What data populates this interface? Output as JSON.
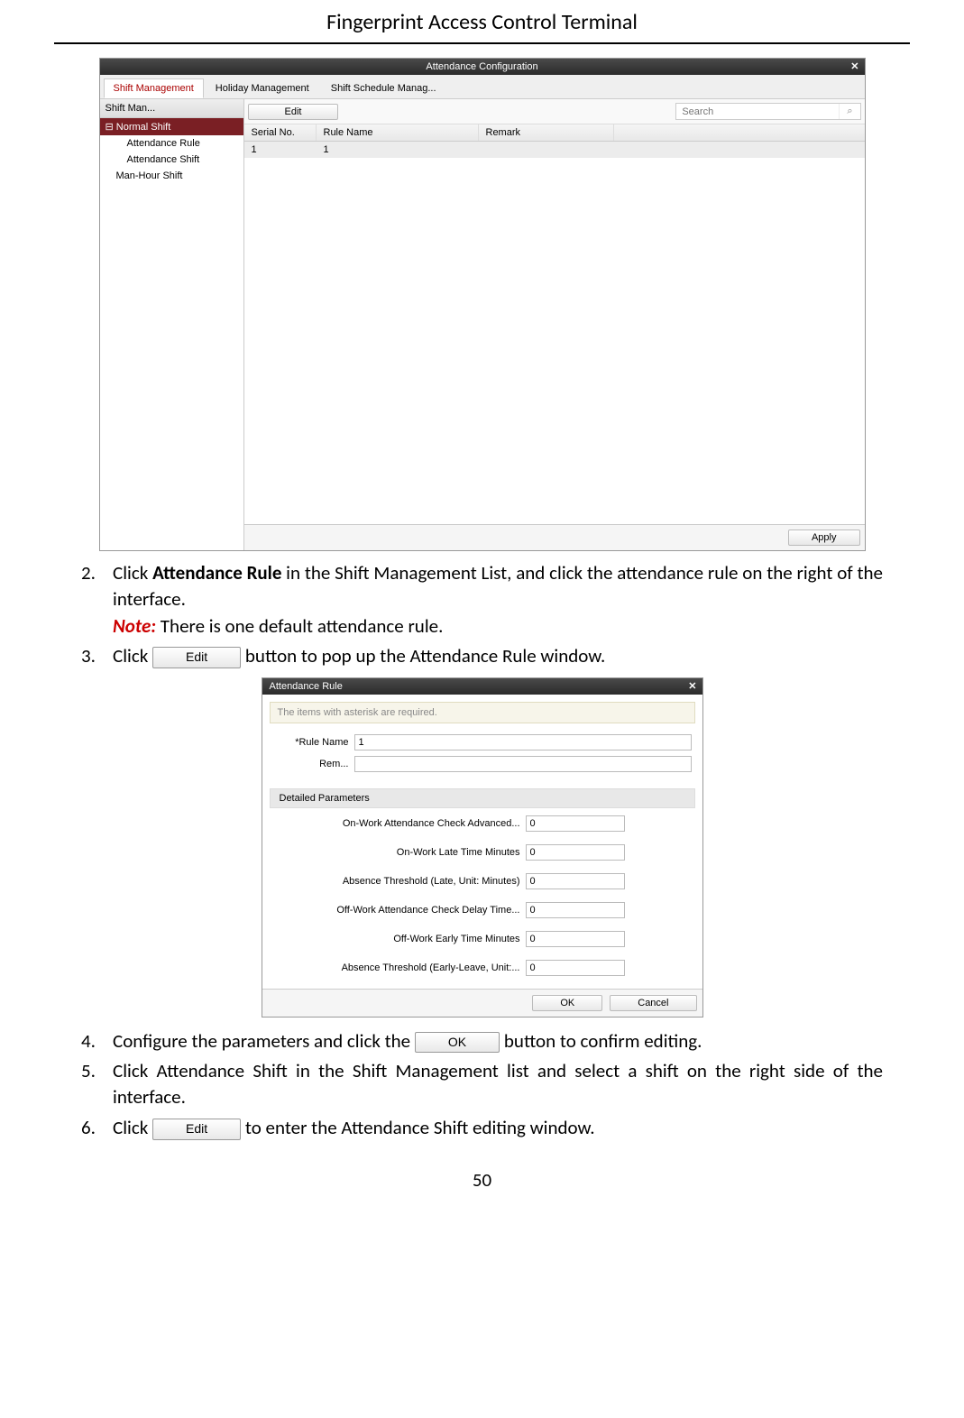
{
  "doc": {
    "header": "Fingerprint Access Control Terminal",
    "page_number": "50"
  },
  "shot1": {
    "title": "Attendance Configuration",
    "tabs": {
      "shift_mgmt": "Shift Management",
      "holiday_mgmt": "Holiday Management",
      "shift_sched": "Shift Schedule Manag..."
    },
    "left_header": "Shift Man...",
    "tree": {
      "normal_shift": "Normal Shift",
      "attendance_rule": "Attendance Rule",
      "attendance_shift": "Attendance Shift",
      "man_hour_shift": "Man-Hour Shift"
    },
    "edit_btn": "Edit",
    "search_placeholder": "Search",
    "grid_headers": {
      "serial": "Serial No.",
      "rule_name": "Rule Name",
      "remark": "Remark"
    },
    "grid_row1": {
      "serial": "1",
      "rule_name": "1"
    },
    "apply_btn": "Apply"
  },
  "steps": {
    "s2_a": "Click ",
    "s2_bold": "Attendance Rule",
    "s2_b": " in the Shift Management List, and click the attendance rule on the right of the interface.",
    "s2_note_label": "Note:",
    "s2_note_body": " There is one default attendance rule.",
    "s3_a": "Click ",
    "s3_b": " button to pop up the Attendance Rule window.",
    "inline_edit": "Edit",
    "s4_a": "Configure the parameters and click the ",
    "s4_b": " button to confirm editing.",
    "inline_ok": "OK",
    "s5": "Click Attendance Shift in the Shift Management list and select a shift on the right side of the interface.",
    "s6_a": "Click ",
    "s6_b": " to enter the Attendance Shift editing window.",
    "n2": "2.",
    "n3": "3.",
    "n4": "4.",
    "n5": "5.",
    "n6": "6."
  },
  "shot2": {
    "title": "Attendance Rule",
    "hint": "The items with asterisk are required.",
    "rule_name_label": "*Rule Name",
    "rule_name_value": "1",
    "rem_label": "Rem...",
    "rem_value": "",
    "detailed_params": "Detailed Parameters",
    "params": {
      "p1": {
        "label": "On-Work Attendance Check Advanced...",
        "value": "0"
      },
      "p2": {
        "label": "On-Work Late Time Minutes",
        "value": "0"
      },
      "p3": {
        "label": "Absence Threshold (Late, Unit: Minutes)",
        "value": "0"
      },
      "p4": {
        "label": "Off-Work Attendance Check Delay Time...",
        "value": "0"
      },
      "p5": {
        "label": "Off-Work Early Time Minutes",
        "value": "0"
      },
      "p6": {
        "label": "Absence Threshold (Early-Leave, Unit:...",
        "value": "0"
      }
    },
    "ok_btn": "OK",
    "cancel_btn": "Cancel"
  }
}
